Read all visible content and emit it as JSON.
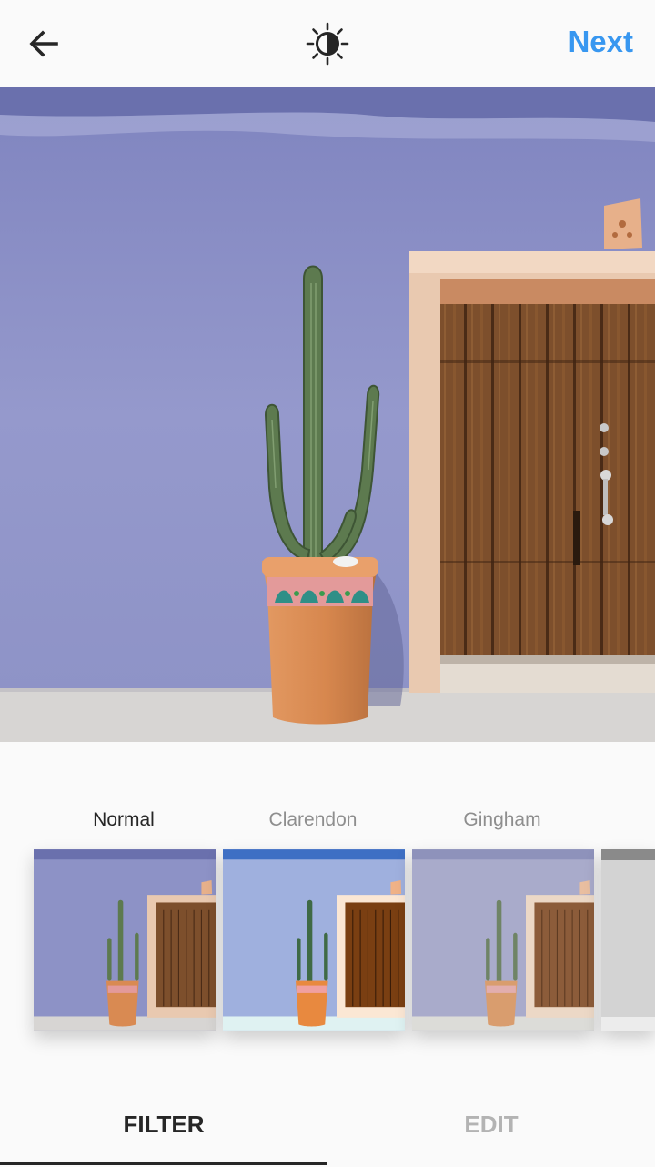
{
  "header": {
    "back_icon": "arrow-left-icon",
    "lux_icon": "lux-brightness-icon",
    "next_label": "Next",
    "accent_color": "#3897f0"
  },
  "photo": {
    "subject": "potted cactus beside wooden door"
  },
  "filters": [
    {
      "label": "Normal",
      "selected": true
    },
    {
      "label": "Clarendon",
      "selected": false
    },
    {
      "label": "Gingham",
      "selected": false
    }
  ],
  "tabs": {
    "filter_label": "FILTER",
    "edit_label": "EDIT",
    "active": "FILTER"
  }
}
